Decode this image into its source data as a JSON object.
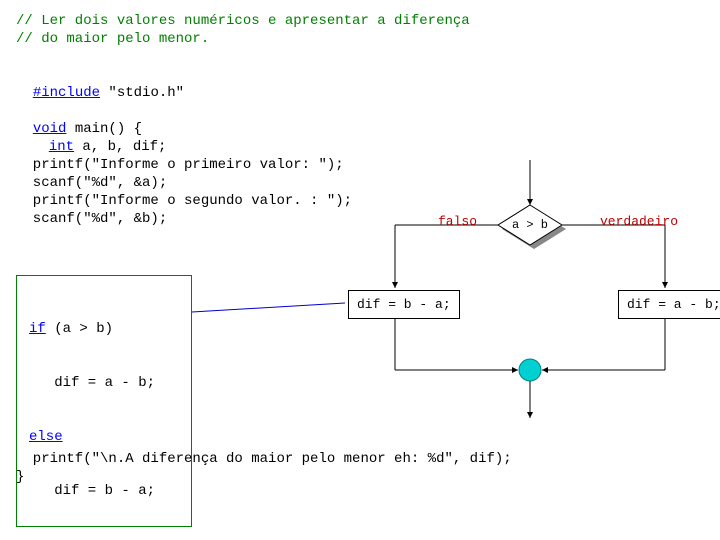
{
  "code": {
    "c1": "// Ler dois valores numéricos e apresentar a diferença",
    "c2": "// do maior pelo menor.",
    "inc_kw": "#include",
    "inc_rest": " \"stdio.h\"",
    "void_kw": "void",
    "main_sig": " main() {",
    "int_kw": "int",
    "decl_rest": " a, b, dif;",
    "p1": "  printf(\"Informe o primeiro valor: \");",
    "s1": "  scanf(\"%d\", &a);",
    "p2": "  printf(\"Informe o segundo valor. : \");",
    "s2": "  scanf(\"%d\", &b);",
    "if_kw": "if",
    "if_cond": " (a > b)",
    "if_body": "   dif = a - b;",
    "else_kw": "else",
    "else_body": "   dif = b - a;",
    "pf": "  printf(\"\\n.A diferença do maior pelo menor eh: %d\", dif);",
    "brace": "}"
  },
  "flow": {
    "condition": "a > b",
    "false_label": "falso",
    "true_label": "verdadeiro",
    "false_box": "dif = b - a;",
    "true_box": "dif = a - b;"
  }
}
